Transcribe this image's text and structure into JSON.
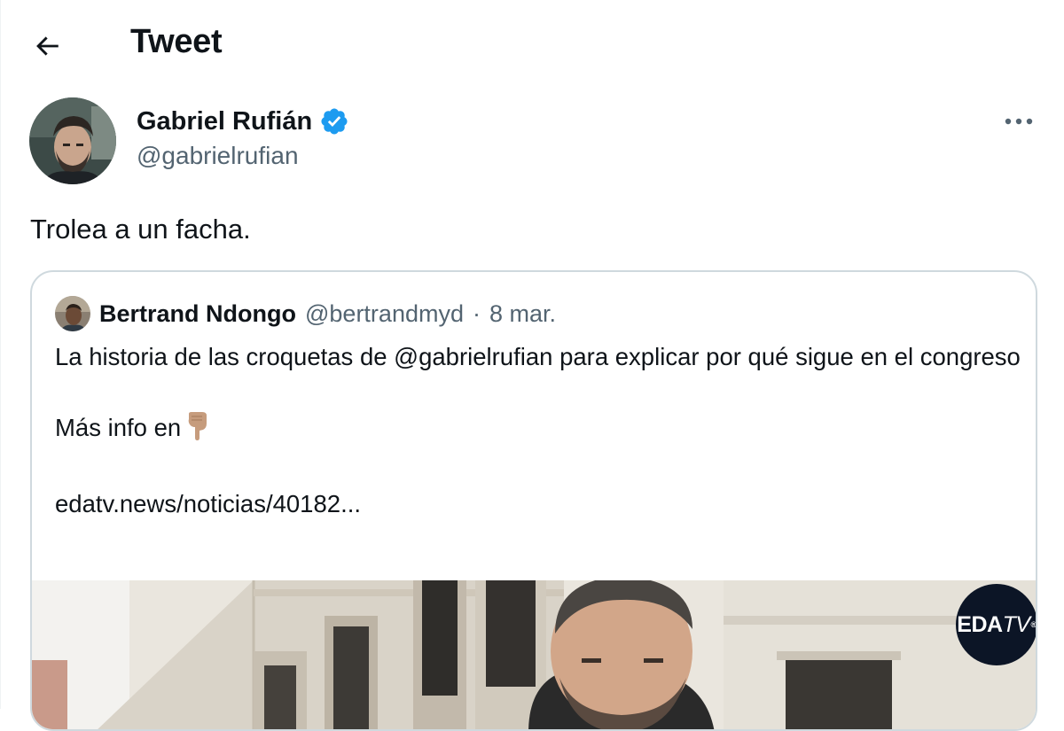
{
  "header": {
    "title": "Tweet",
    "back_icon": "arrow-left-icon"
  },
  "author": {
    "name": "Gabriel Rufián",
    "handle": "@gabrielrufian",
    "verified": true,
    "verified_color": "#1d9bf0"
  },
  "tweet": {
    "text": "Trolea a un facha."
  },
  "quoted_tweet": {
    "author_name": "Bertrand Ndongo",
    "author_handle": "@bertrandmyd",
    "separator": "·",
    "date": "8 mar.",
    "paragraphs": [
      "La historia de las croquetas de @gabrielrufian para explicar por qué sigue en el congreso",
      "Más info en",
      "edatv.news/noticias/40182..."
    ],
    "media_logo": {
      "main": "EDA",
      "suffix": "TV",
      "mark": "®"
    }
  },
  "colors": {
    "text_primary": "#0f1419",
    "text_secondary": "#536471",
    "border": "#cfd9de",
    "accent": "#1d9bf0"
  }
}
